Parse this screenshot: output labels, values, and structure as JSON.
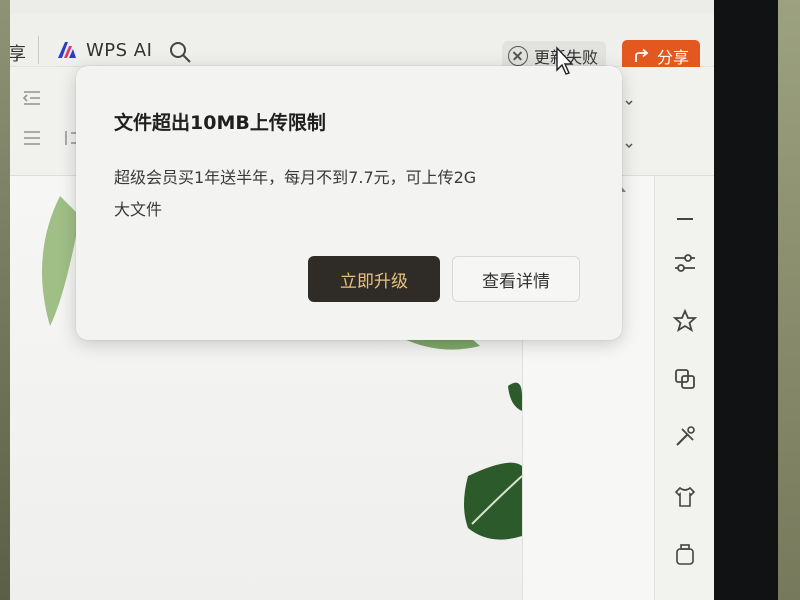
{
  "topbar": {
    "cut_label": "享",
    "wps_ai_label": "WPS AI",
    "update_fail_label": "更新失败",
    "share_label": "分享"
  },
  "dialog": {
    "title": "文件超出10MB上传限制",
    "body_line1": "超级会员买1年送半年，每月不到7.7元，可上传2G",
    "body_line2": "大文件",
    "upgrade_label": "立即升级",
    "details_label": "查看详情"
  },
  "colors": {
    "share_bg": "#e2581f",
    "upgrade_bg": "#2f2b27",
    "upgrade_text": "#e9c37d"
  },
  "icons": {
    "top_search": "search-icon",
    "update_fail": "close-circle-icon",
    "share": "share-icon",
    "rail": [
      "minimize-icon",
      "settings-sliders-icon",
      "star-icon",
      "compare-icon",
      "tools-icon",
      "clothes-icon",
      "bottle-icon"
    ]
  }
}
